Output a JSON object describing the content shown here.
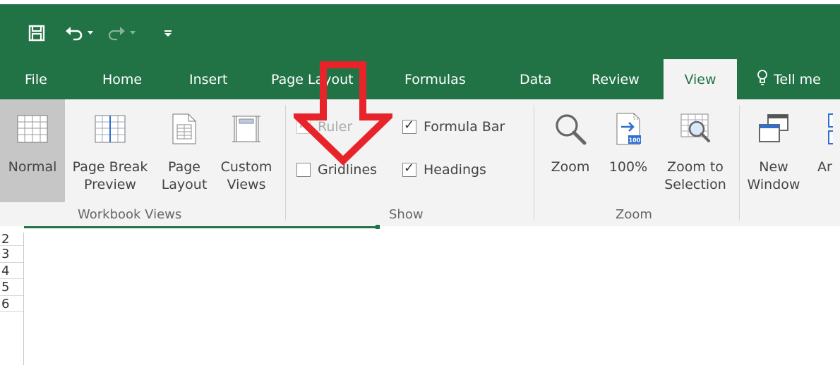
{
  "quick_access": {
    "icons": [
      "save-icon",
      "undo-icon",
      "redo-icon",
      "customize-qat-icon"
    ]
  },
  "tabs": [
    {
      "label": "File"
    },
    {
      "label": "Home"
    },
    {
      "label": "Insert"
    },
    {
      "label": "Page Layout"
    },
    {
      "label": "Formulas"
    },
    {
      "label": "Data"
    },
    {
      "label": "Review"
    },
    {
      "label": "View",
      "active": true
    },
    {
      "label": "Tell me"
    }
  ],
  "ribbon": {
    "workbook_views": {
      "label": "Workbook Views",
      "buttons": [
        {
          "label": "Normal",
          "selected": true
        },
        {
          "label": "Page Break\nPreview"
        },
        {
          "label": "Page\nLayout"
        },
        {
          "label": "Custom\nViews"
        }
      ]
    },
    "show": {
      "label": "Show",
      "ruler": {
        "label": "Ruler",
        "checked": true,
        "disabled": true
      },
      "formula_bar": {
        "label": "Formula Bar",
        "checked": true
      },
      "gridlines": {
        "label": "Gridlines",
        "checked": false
      },
      "headings": {
        "label": "Headings",
        "checked": true
      }
    },
    "zoom": {
      "label": "Zoom",
      "buttons": [
        {
          "label": "Zoom"
        },
        {
          "label": "100%"
        },
        {
          "label": "Zoom to\nSelection"
        }
      ]
    },
    "window": {
      "buttons": [
        {
          "label": "New\nWindow"
        },
        {
          "label": "Ar"
        }
      ]
    }
  },
  "sheet": {
    "row_numbers": [
      "2",
      "3",
      "4",
      "5",
      "6"
    ]
  },
  "colors": {
    "accent": "#217346",
    "ribbon_bg": "#f3f3f3",
    "annotation": "#e8242b"
  }
}
